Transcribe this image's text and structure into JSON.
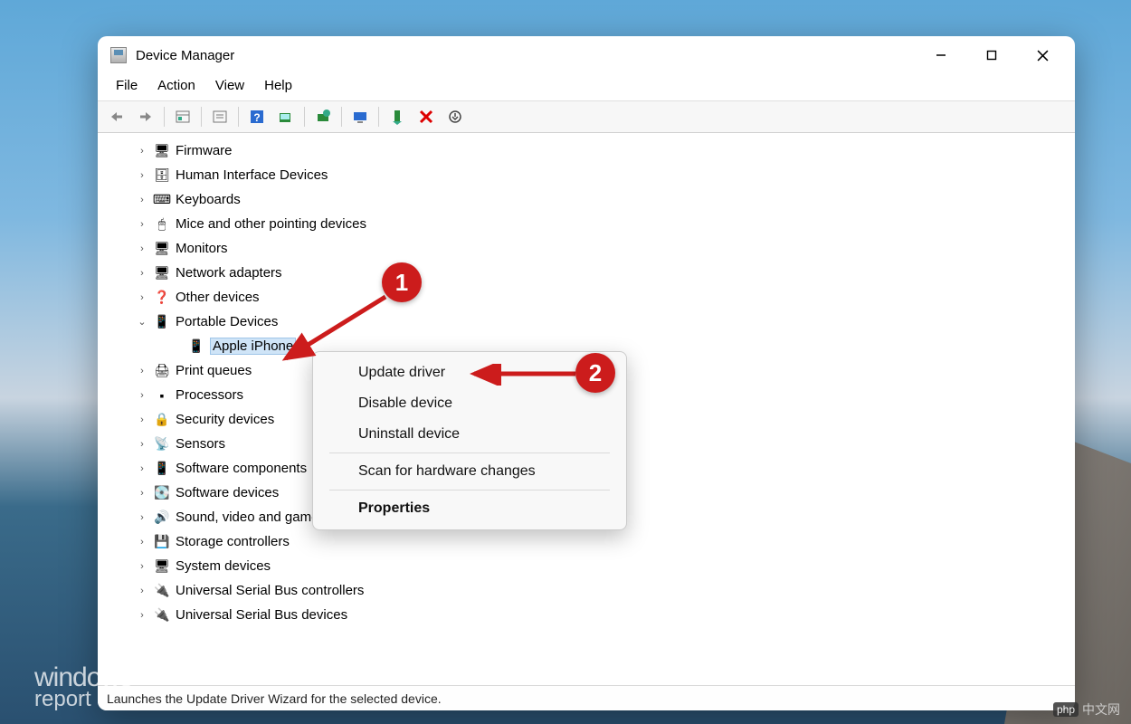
{
  "window": {
    "title": "Device Manager"
  },
  "menubar": {
    "file": "File",
    "action": "Action",
    "view": "View",
    "help": "Help"
  },
  "tree": {
    "items": [
      {
        "label": "Firmware",
        "icon": "🖥",
        "expandable": true
      },
      {
        "label": "Human Interface Devices",
        "icon": "🗄",
        "expandable": true
      },
      {
        "label": "Keyboards",
        "icon": "⌨",
        "expandable": true
      },
      {
        "label": "Mice and other pointing devices",
        "icon": "🖱",
        "expandable": true
      },
      {
        "label": "Monitors",
        "icon": "🖥",
        "expandable": true
      },
      {
        "label": "Network adapters",
        "icon": "🖥",
        "expandable": true
      },
      {
        "label": "Other devices",
        "icon": "❓",
        "expandable": true
      },
      {
        "label": "Portable Devices",
        "icon": "📱",
        "expandable": true,
        "expanded": true
      },
      {
        "label": "Apple iPhone",
        "icon": "📱",
        "child": true,
        "selected": true
      },
      {
        "label": "Print queues",
        "icon": "🖨",
        "expandable": true
      },
      {
        "label": "Processors",
        "icon": "▪",
        "expandable": true
      },
      {
        "label": "Security devices",
        "icon": "🔒",
        "expandable": true
      },
      {
        "label": "Sensors",
        "icon": "📡",
        "expandable": true
      },
      {
        "label": "Software components",
        "icon": "📱",
        "expandable": true
      },
      {
        "label": "Software devices",
        "icon": "💽",
        "expandable": true
      },
      {
        "label": "Sound, video and game controllers",
        "icon": "🔊",
        "expandable": true
      },
      {
        "label": "Storage controllers",
        "icon": "💾",
        "expandable": true
      },
      {
        "label": "System devices",
        "icon": "🖥",
        "expandable": true
      },
      {
        "label": "Universal Serial Bus controllers",
        "icon": "🔌",
        "expandable": true
      },
      {
        "label": "Universal Serial Bus devices",
        "icon": "🔌",
        "expandable": true
      }
    ]
  },
  "context_menu": {
    "update_driver": "Update driver",
    "disable_device": "Disable device",
    "uninstall_device": "Uninstall device",
    "scan_hardware": "Scan for hardware changes",
    "properties": "Properties"
  },
  "statusbar": {
    "text": "Launches the Update Driver Wizard for the selected device."
  },
  "annotations": {
    "badge1": "1",
    "badge2": "2"
  },
  "watermark": {
    "left_line1": "windows",
    "left_line2": "report",
    "right": "中文网",
    "right_prefix": "php"
  }
}
